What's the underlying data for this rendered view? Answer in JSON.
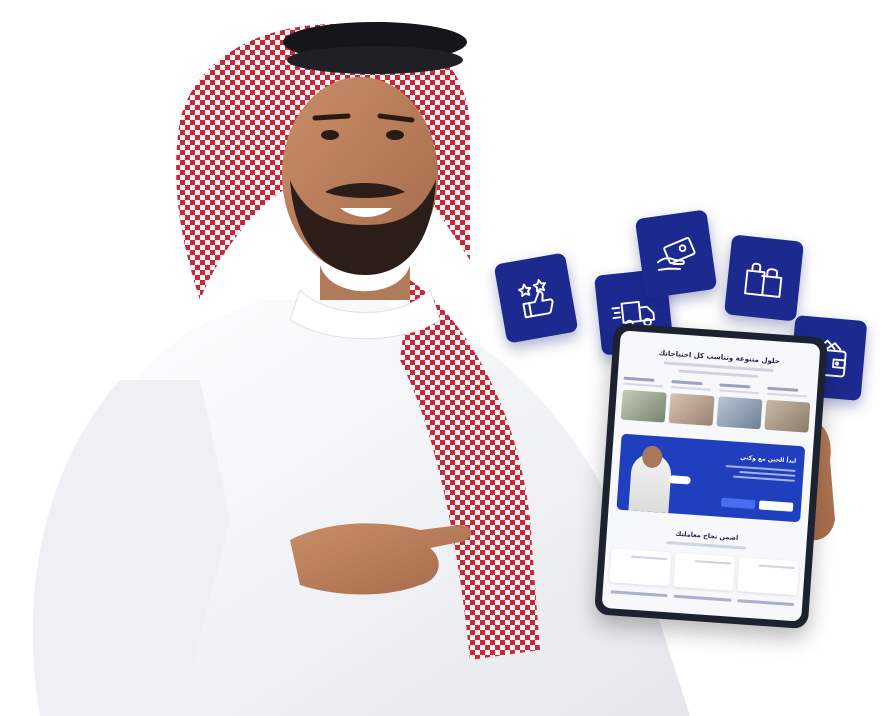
{
  "scene": {
    "subject": "person",
    "device": "tablet"
  },
  "colors": {
    "card_blue": "#1c2a8f",
    "icon_stroke": "#ffffff",
    "banner_blue": "#1f3fbf",
    "heading_navy": "#1b2450"
  },
  "icons": [
    {
      "name": "rating-thumbs-up-icon"
    },
    {
      "name": "delivery-truck-icon"
    },
    {
      "name": "payment-card-icon"
    },
    {
      "name": "shopping-bags-icon"
    },
    {
      "name": "wallet-icon"
    }
  ],
  "tablet_screen": {
    "heading": "حلول متنوعة وتناسب كل احتياجاتك",
    "banner_title": "ابدأ الحين مع وكني",
    "section_heading": "اضمن نجاح معاملتك"
  }
}
